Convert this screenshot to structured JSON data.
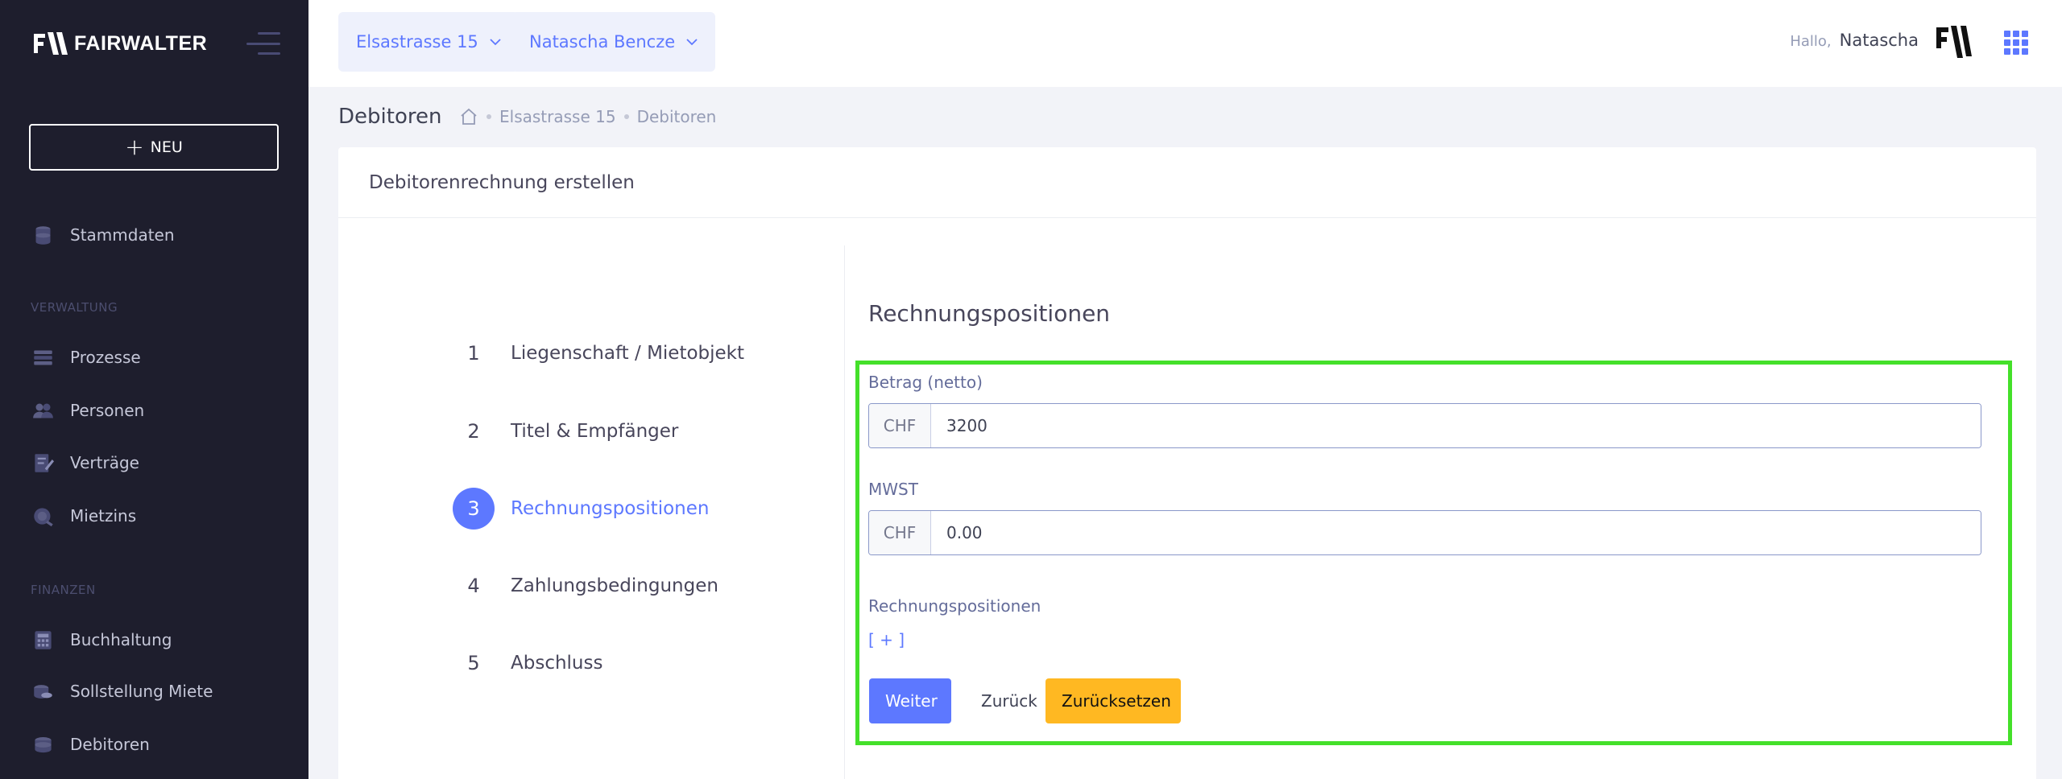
{
  "brand": {
    "name": "FAIRWALTER"
  },
  "sidebar": {
    "new_label": "NEU",
    "items": [
      {
        "label": "Stammdaten",
        "icon": "database-icon"
      },
      {
        "label": "Prozesse",
        "icon": "process-icon"
      },
      {
        "label": "Personen",
        "icon": "people-icon"
      },
      {
        "label": "Verträge",
        "icon": "contract-icon"
      },
      {
        "label": "Mietzins",
        "icon": "rent-icon"
      },
      {
        "label": "Buchhaltung",
        "icon": "calculator-icon"
      },
      {
        "label": "Sollstellung Miete",
        "icon": "coins-icon"
      },
      {
        "label": "Debitoren",
        "icon": "coins-stack-icon"
      }
    ],
    "sections": [
      "VERWALTUNG",
      "FINANZEN"
    ]
  },
  "header": {
    "property_dropdown": "Elsastrasse 15",
    "person_dropdown": "Natascha Bencze",
    "greeting": "Hallo,",
    "user_name": "Natascha"
  },
  "subheader": {
    "title": "Debitoren",
    "breadcrumb": [
      "Elsastrasse 15",
      "Debitoren"
    ]
  },
  "card": {
    "title": "Debitorenrechnung erstellen",
    "steps": [
      {
        "num": "1",
        "label": "Liegenschaft / Mietobjekt"
      },
      {
        "num": "2",
        "label": "Titel & Empfänger"
      },
      {
        "num": "3",
        "label": "Rechnungspositionen"
      },
      {
        "num": "4",
        "label": "Zahlungsbedingungen"
      },
      {
        "num": "5",
        "label": "Abschluss"
      }
    ],
    "active_step": 3
  },
  "form": {
    "title": "Rechnungspositionen",
    "amount_label": "Betrag (netto)",
    "amount_currency": "CHF",
    "amount_value": "3200",
    "vat_label": "MWST",
    "vat_currency": "CHF",
    "vat_value": "0.00",
    "positions_label": "Rechnungspositionen",
    "add_label": "[ + ]",
    "next_label": "Weiter",
    "back_label": "Zurück",
    "reset_label": "Zurücksetzen"
  },
  "colors": {
    "sidebar_bg": "#1e1e2d",
    "accent": "#5d78ff",
    "warning": "#ffb822",
    "highlight": "#44e02a"
  }
}
